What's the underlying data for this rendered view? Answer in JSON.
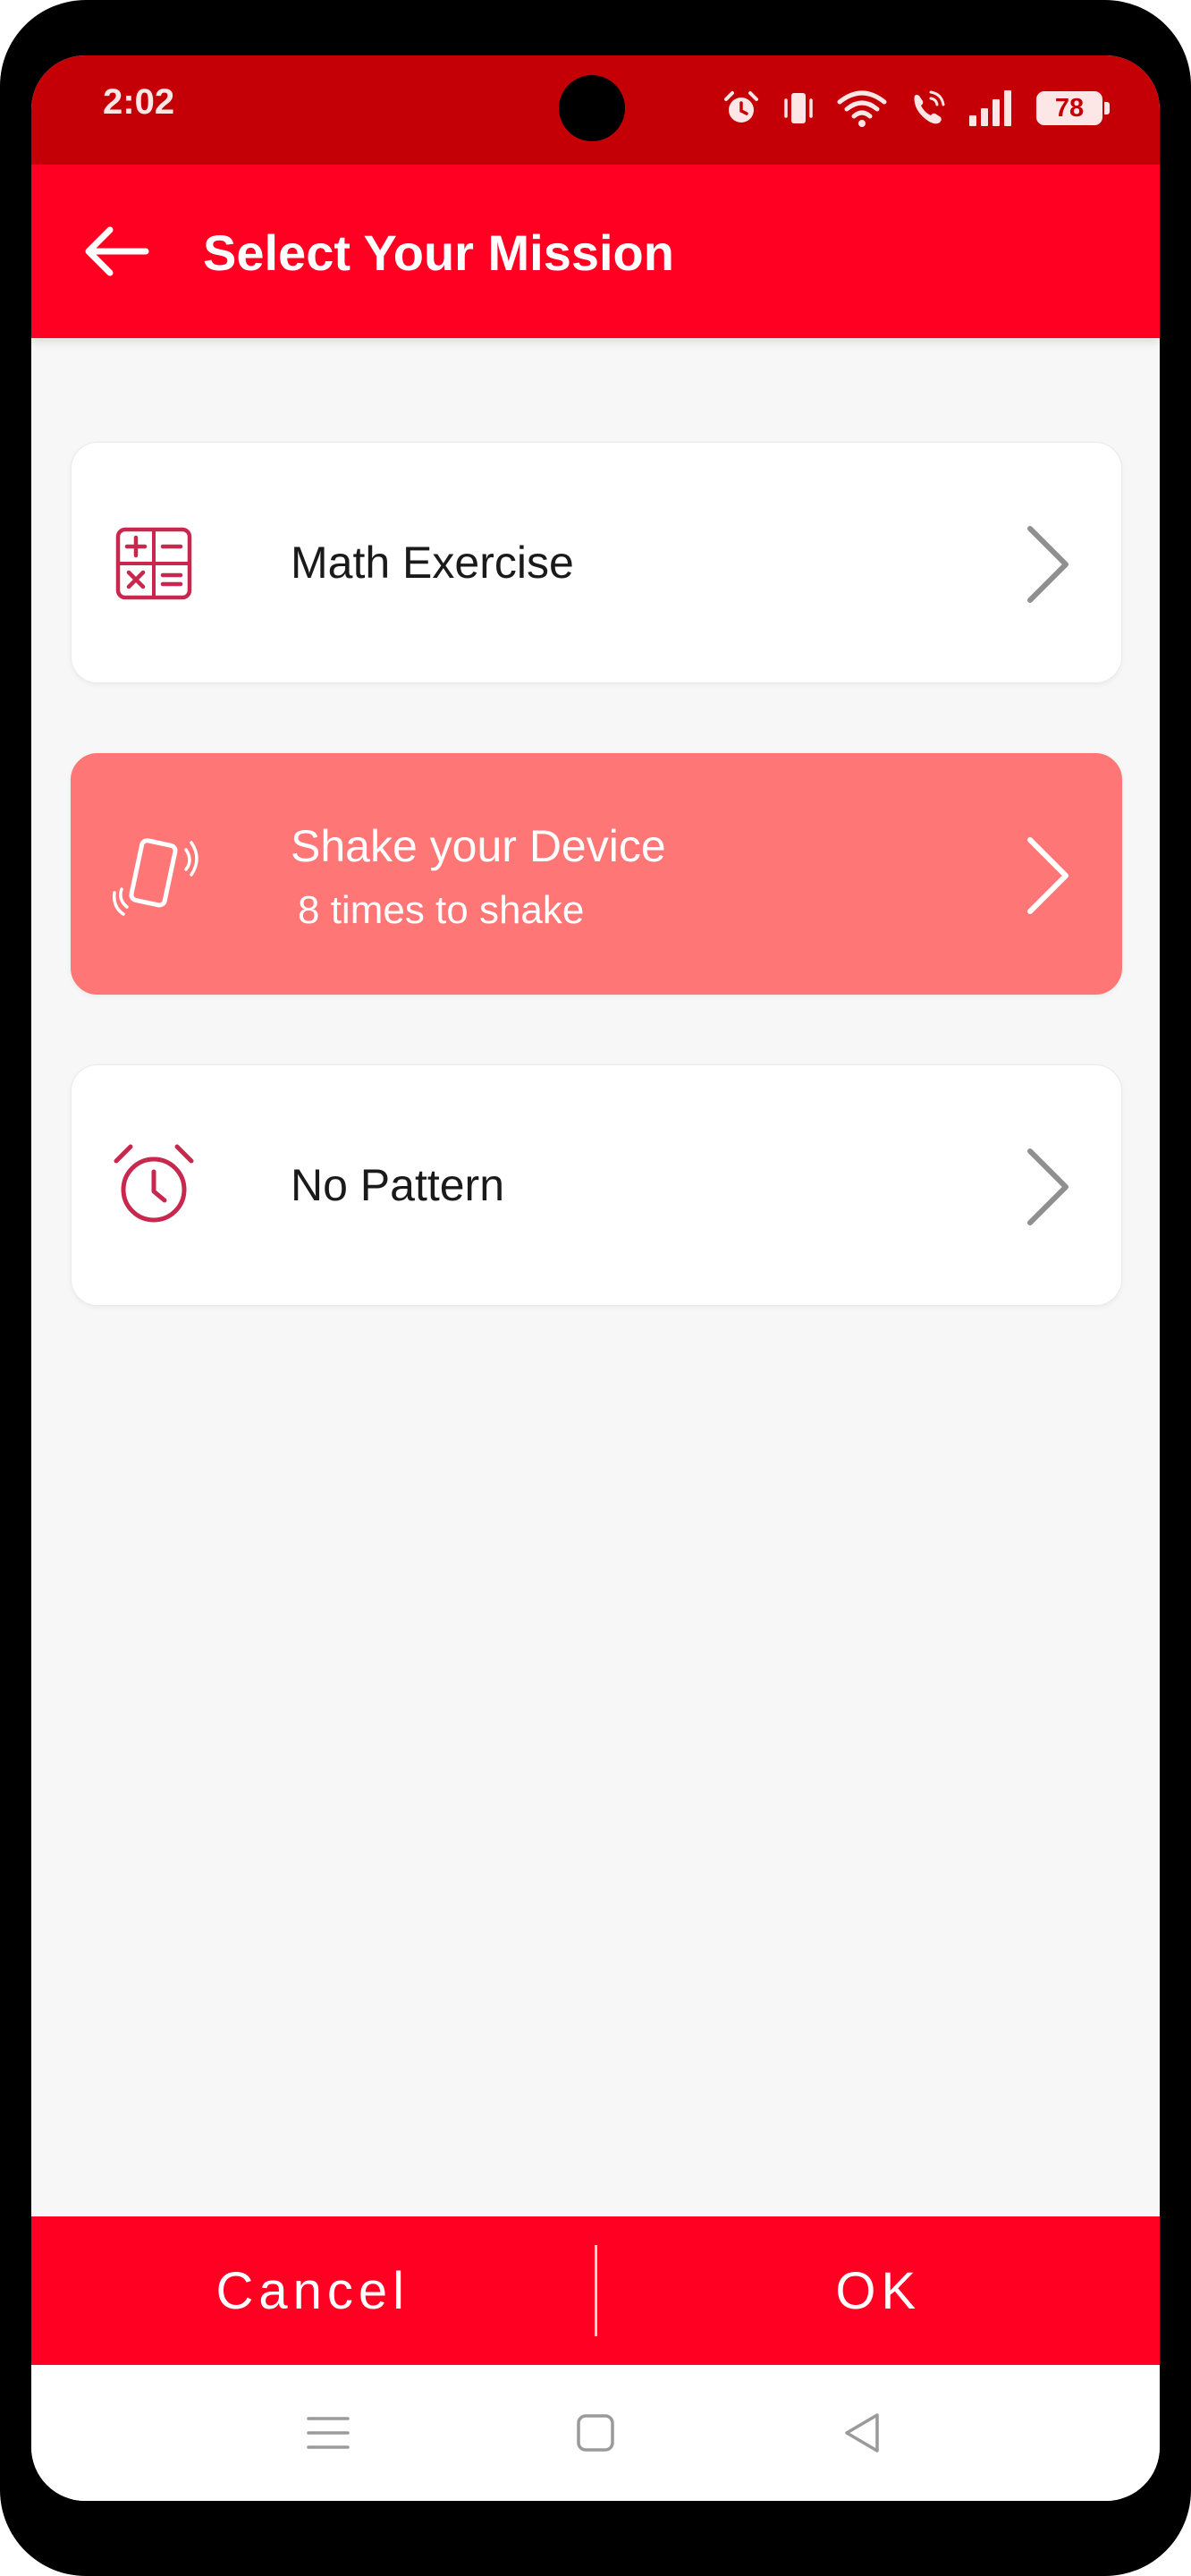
{
  "status_bar": {
    "time": "2:02",
    "battery": "78",
    "icons": [
      "alarm-icon",
      "vibrate-icon",
      "wifi-icon",
      "wifi-calling-icon",
      "signal-icon",
      "battery-icon"
    ]
  },
  "app_bar": {
    "back_icon": "arrow-left-icon",
    "title": "Select Your Mission"
  },
  "missions": [
    {
      "title": "Math Exercise",
      "subtitle": "",
      "icon": "calculator-icon",
      "selected": false
    },
    {
      "title": "Shake your Device",
      "subtitle": "8 times to shake",
      "icon": "shake-phone-icon",
      "selected": true
    },
    {
      "title": "No Pattern",
      "subtitle": "",
      "icon": "alarm-clock-icon",
      "selected": false
    }
  ],
  "buttons": {
    "cancel": "Cancel",
    "ok": "OK"
  },
  "nav_bar": {
    "icons": [
      "menu-icon",
      "home-icon",
      "back-icon"
    ]
  },
  "colors": {
    "status_bar": "#c40006",
    "primary": "#ff0022",
    "selected_card": "#ff7676",
    "icon_tint": "#c8284d",
    "background": "#f7f7f7"
  }
}
